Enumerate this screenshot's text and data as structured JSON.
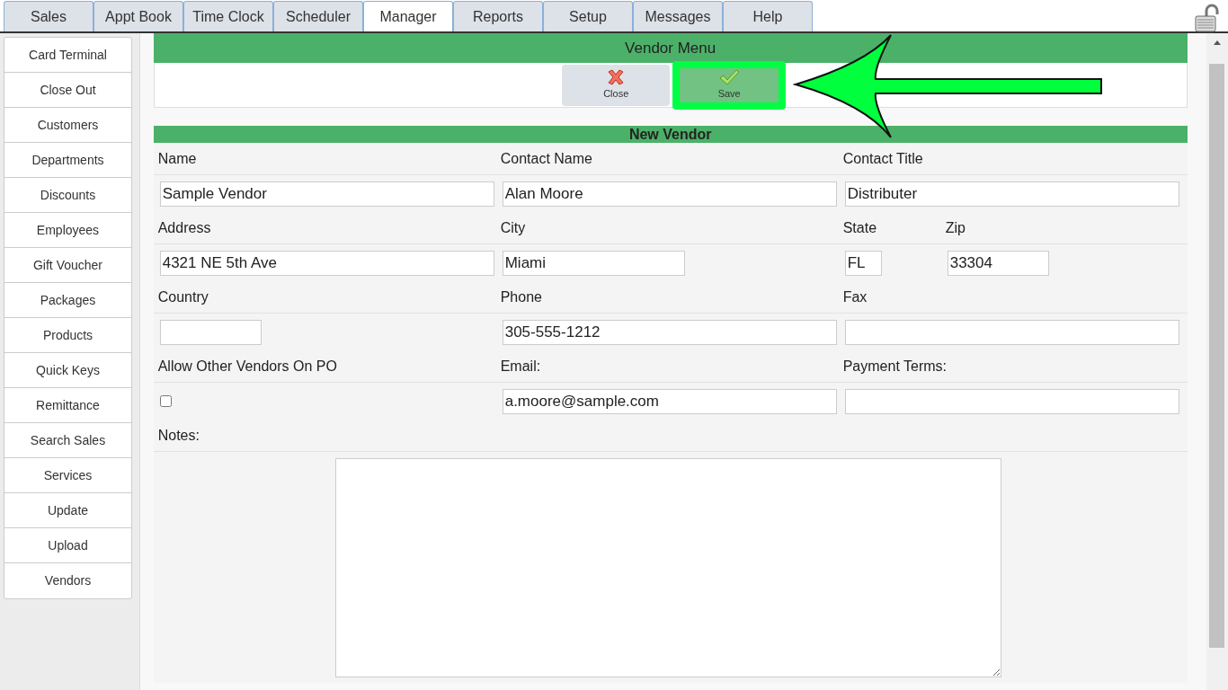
{
  "tabs": [
    {
      "label": "Sales",
      "selected": false
    },
    {
      "label": "Appt Book",
      "selected": false
    },
    {
      "label": "Time Clock",
      "selected": false
    },
    {
      "label": "Scheduler",
      "selected": false
    },
    {
      "label": "Manager",
      "selected": true
    },
    {
      "label": "Reports",
      "selected": false
    },
    {
      "label": "Setup",
      "selected": false
    },
    {
      "label": "Messages",
      "selected": false
    },
    {
      "label": "Help",
      "selected": false
    }
  ],
  "sidebar": {
    "items": [
      "Card Terminal",
      "Close Out",
      "Customers",
      "Departments",
      "Discounts",
      "Employees",
      "Gift Voucher",
      "Packages",
      "Products",
      "Quick Keys",
      "Remittance",
      "Search Sales",
      "Services",
      "Update",
      "Upload",
      "Vendors"
    ]
  },
  "menu": {
    "title": "Vendor Menu",
    "buttons": [
      {
        "label": "Close",
        "kind": "close",
        "highlighted": false
      },
      {
        "label": "Save",
        "kind": "save",
        "highlighted": true
      }
    ]
  },
  "form": {
    "title": "New Vendor",
    "rows": [
      [
        {
          "label": "Name",
          "value": "Sample Vendor",
          "kind": "text"
        },
        {
          "label": "Contact Name",
          "value": "Alan Moore",
          "kind": "text"
        },
        {
          "label": "Contact Title",
          "value": "Distributer",
          "kind": "text"
        }
      ],
      [
        {
          "label": "Address",
          "value": "4321 NE 5th Ave",
          "kind": "text"
        },
        {
          "label": "City",
          "value": "Miami",
          "kind": "text"
        },
        {
          "label": "State",
          "value": "FL",
          "kind": "text"
        },
        {
          "label": "Zip",
          "value": "33304",
          "kind": "text"
        }
      ],
      [
        {
          "label": "Country",
          "kind": "text"
        },
        {
          "label": "Phone",
          "value": "305-555-1212",
          "kind": "text"
        },
        {
          "label": "Fax",
          "kind": "text"
        }
      ],
      [
        {
          "label": "Allow Other Vendors On PO",
          "checked": false,
          "kind": "checkbox"
        },
        {
          "label": "Email:",
          "value": "a.moore@sample.com",
          "kind": "text"
        },
        {
          "label": "Payment Terms:",
          "kind": "text"
        }
      ]
    ],
    "notes": {
      "label": "Notes:"
    }
  }
}
